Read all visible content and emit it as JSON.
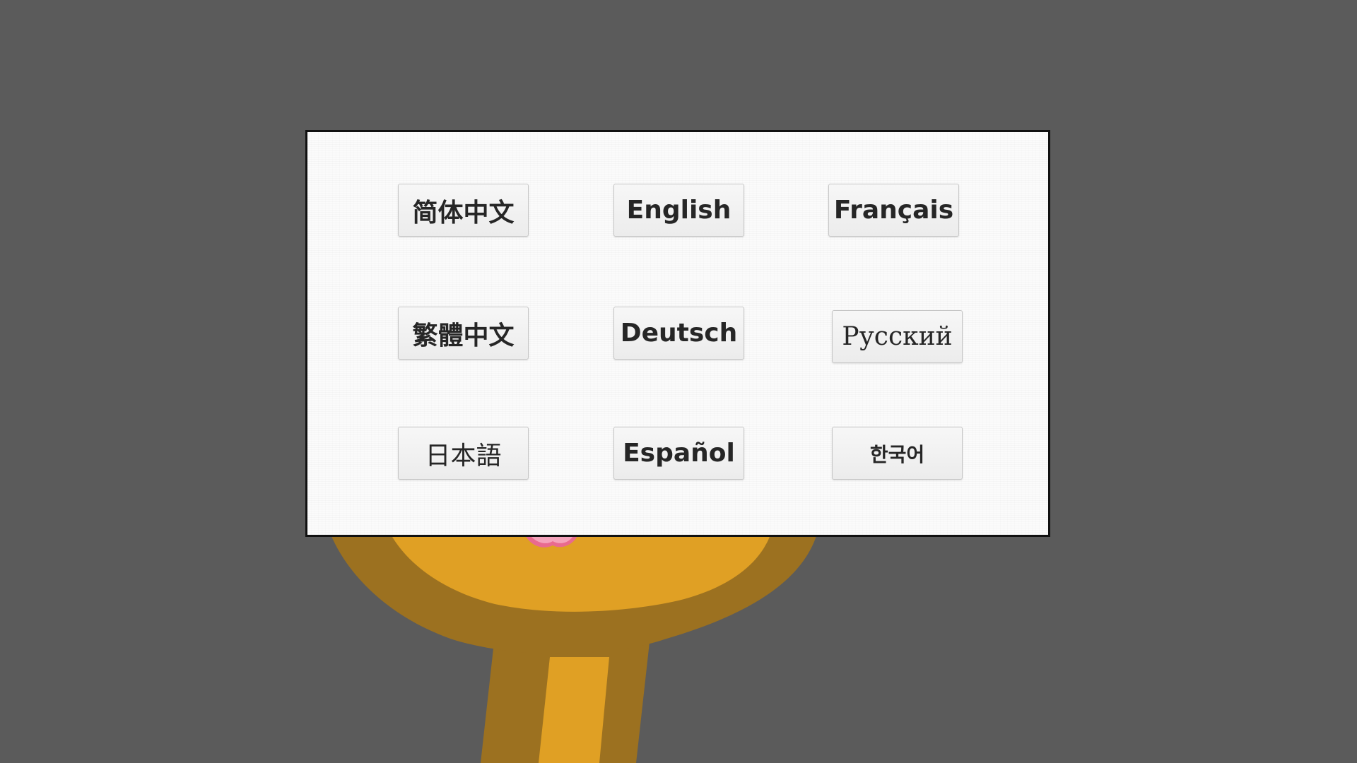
{
  "languages": {
    "simplified_chinese": "简体中文",
    "english": "English",
    "french": "Français",
    "traditional_chinese": "繁體中文",
    "german": "Deutsch",
    "russian": "Русский",
    "japanese": "日本語",
    "spanish": "Español",
    "korean": "한국어"
  },
  "colors": {
    "background": "#5b5b5b",
    "panel": "#fbfbfb",
    "character_fill": "#e0a024",
    "character_outline": "#9c7120",
    "flower": "#e96a8f"
  }
}
